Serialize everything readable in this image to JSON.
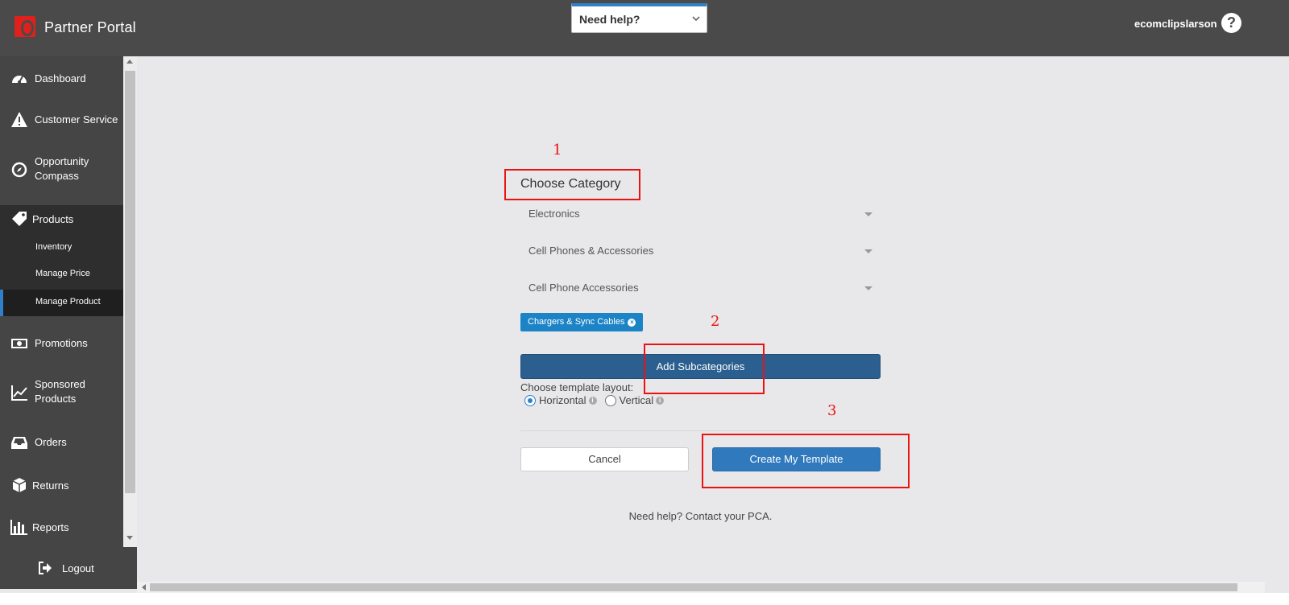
{
  "header": {
    "app_title": "Partner Portal",
    "help_dropdown": "Need help?",
    "username": "ecomclipslarson",
    "help_icon": "?"
  },
  "sidebar": {
    "items": [
      {
        "label": "Dashboard",
        "icon": "dashboard-icon"
      },
      {
        "label": "Customer Service",
        "icon": "warning-icon"
      },
      {
        "label": "Opportunity Compass",
        "icon": "compass-icon"
      },
      {
        "label": "Products",
        "icon": "tag-icon"
      },
      {
        "label": "Promotions",
        "icon": "money-icon"
      },
      {
        "label": "Sponsored Products",
        "icon": "chart-line-icon"
      },
      {
        "label": "Orders",
        "icon": "inbox-icon"
      },
      {
        "label": "Returns",
        "icon": "return-box-icon"
      },
      {
        "label": "Reports",
        "icon": "bar-chart-icon"
      }
    ],
    "products_sub": [
      {
        "label": "Inventory"
      },
      {
        "label": "Manage Price"
      },
      {
        "label": "Manage Product",
        "active": true
      }
    ],
    "logout": "Logout"
  },
  "form": {
    "title": "Choose Category",
    "selects": [
      {
        "value": "Electronics"
      },
      {
        "value": "Cell Phones & Accessories"
      },
      {
        "value": "Cell Phone Accessories"
      }
    ],
    "chip": "Chargers & Sync Cables",
    "add_button": "Add Subcategories",
    "layout_label": "Choose template layout:",
    "layout_options": [
      {
        "label": "Horizontal",
        "selected": true
      },
      {
        "label": "Vertical",
        "selected": false
      }
    ],
    "cancel": "Cancel",
    "create": "Create My Template",
    "help_text": "Need help? Contact your PCA."
  },
  "annotations": [
    "1",
    "2",
    "3"
  ],
  "colors": {
    "topbar": "#4a4a4a",
    "sidebar": "#454545",
    "accent_blue": "#2f80c8",
    "annotation_red": "#ee1111"
  }
}
